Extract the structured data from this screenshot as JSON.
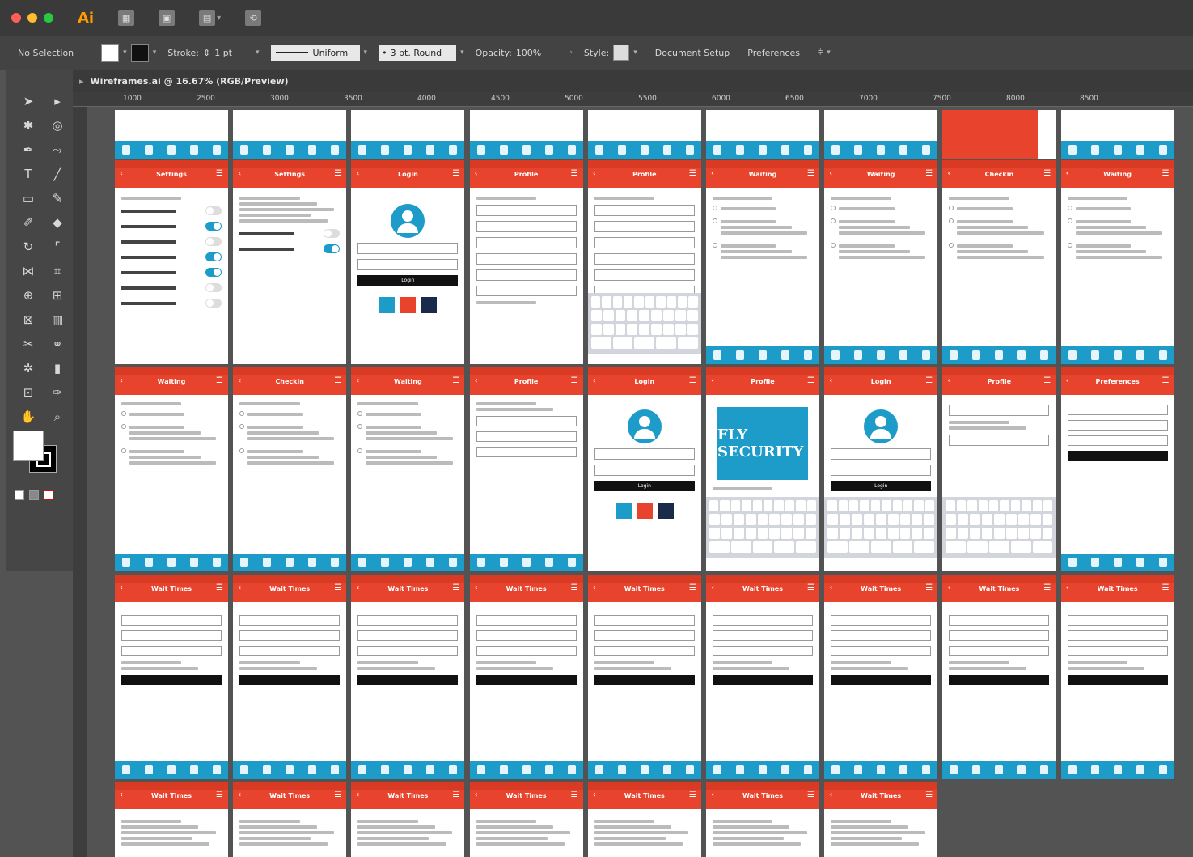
{
  "app": {
    "logo": "Ai"
  },
  "control_bar": {
    "selection": "No Selection",
    "stroke_label": "Stroke:",
    "stroke_value": "1 pt",
    "stroke_profile": "Uniform",
    "brush": "3 pt. Round",
    "opacity_label": "Opacity:",
    "opacity_value": "100%",
    "style_label": "Style:",
    "document_setup": "Document Setup",
    "preferences": "Preferences"
  },
  "document_tab": {
    "title": "Wireframes.ai @ 16.67% (RGB/Preview)"
  },
  "ruler_labels": [
    "1000",
    "2500",
    "3000",
    "3500",
    "4000",
    "4500",
    "5000",
    "5500",
    "6000",
    "6500",
    "7000",
    "7500",
    "8000",
    "8500"
  ],
  "colors": {
    "accent_red": "#e8432c",
    "accent_blue": "#1d9bc9"
  },
  "artboard_titles": {
    "row1": [
      "Settings",
      "Settings",
      "Login",
      "Profile",
      "Profile",
      "Waiting",
      "Waiting",
      "Checkin",
      "Waiting"
    ],
    "row2": [
      "Waiting",
      "Checkin",
      "Waiting",
      "Profile",
      "Login",
      "Profile",
      "Login",
      "Profile",
      "Preferences"
    ],
    "row3": [
      "Wait Times",
      "Wait Times",
      "Wait Times",
      "Wait Times",
      "Wait Times",
      "Wait Times",
      "Wait Times",
      "Wait Times",
      "Wait Times"
    ],
    "row4": [
      "Wait Times",
      "Wait Times",
      "Wait Times",
      "Wait Times",
      "Wait Times",
      "Wait Times",
      "Wait Times"
    ]
  },
  "login_button": "Login",
  "fly_logo": "FLY SECURITY"
}
